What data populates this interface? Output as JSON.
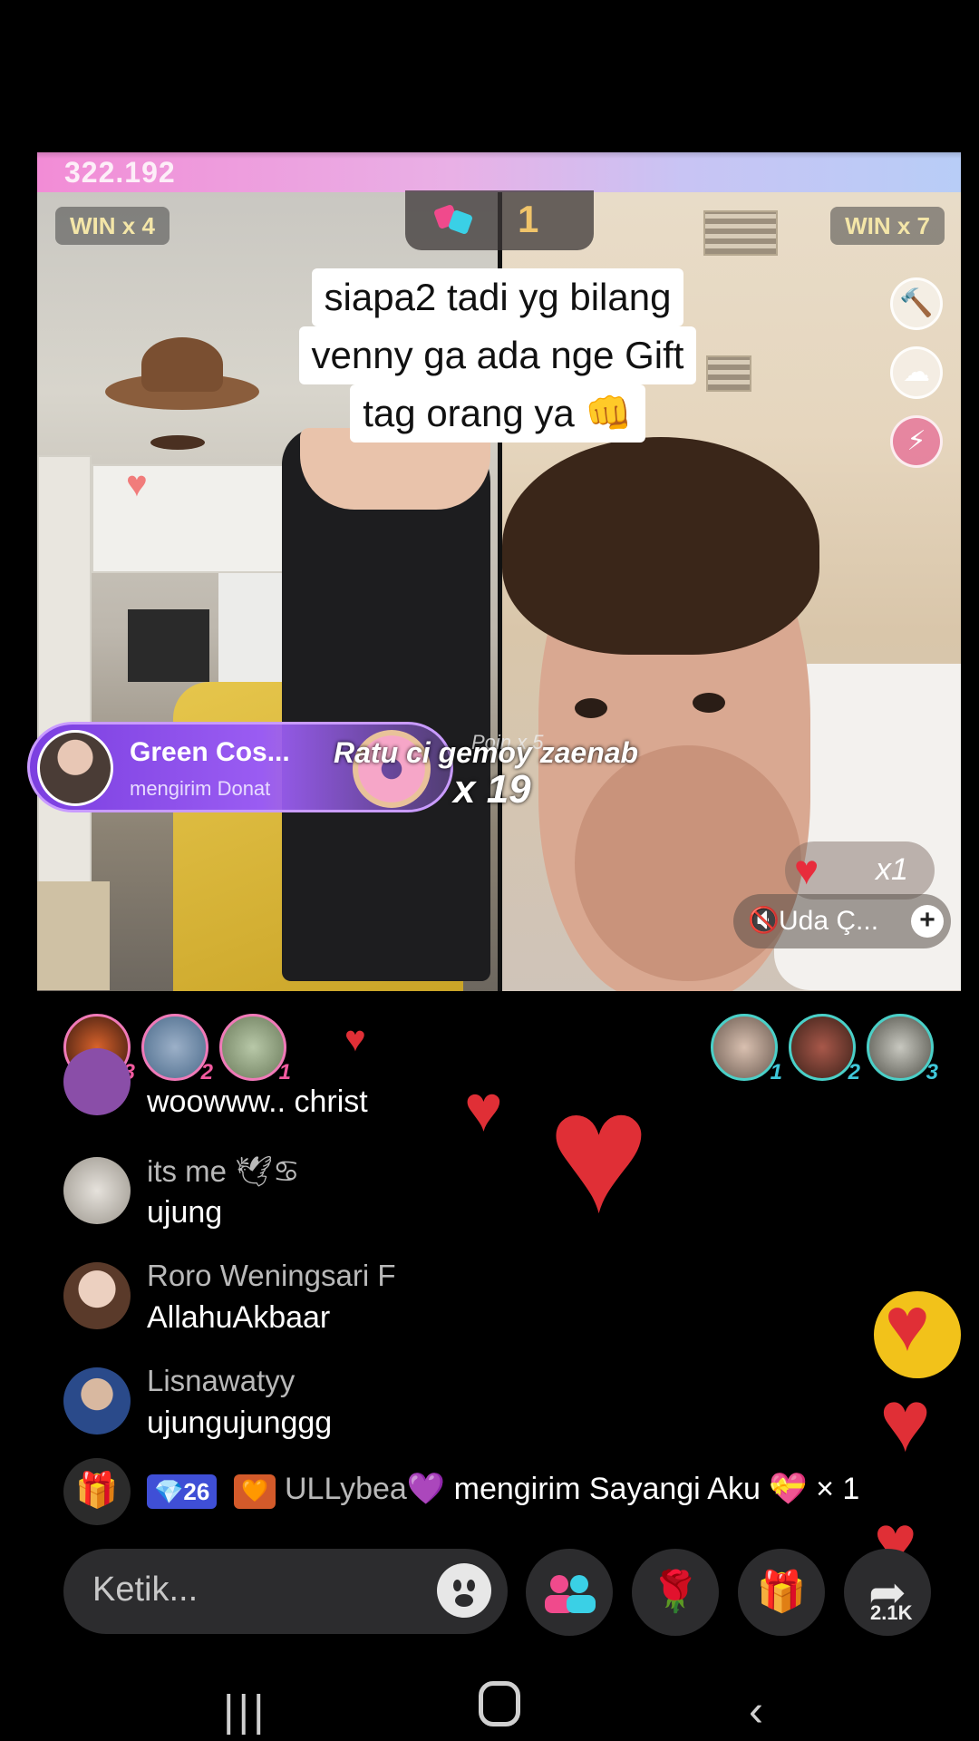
{
  "battle": {
    "score": "322.192",
    "win_left": "WIN x 4",
    "win_right": "WIN x 7",
    "round": "1",
    "caption_lines": [
      "siapa2 tadi yg bilang",
      "venny ga ada nge Gift",
      "tag orang ya 👊"
    ]
  },
  "gift_toast": {
    "sender": "Green Cos...",
    "action": "mengirim Donat",
    "overlay_name": "Ratu ci gemoy zaenab",
    "overlay_count": "x 19",
    "poin": "Poin x 5"
  },
  "heart_counter": {
    "count": "x1"
  },
  "opponent": {
    "name": "Uda Ç..."
  },
  "supporters_left": [
    {
      "rank": "3"
    },
    {
      "rank": "2"
    },
    {
      "rank": "1"
    }
  ],
  "supporters_right": [
    {
      "rank": "1"
    },
    {
      "rank": "2"
    },
    {
      "rank": "3"
    }
  ],
  "chat": [
    {
      "user": "",
      "message": "woowww.. christ"
    },
    {
      "user": "its me 🕊♋",
      "message": "ujung"
    },
    {
      "user": "Roro Weningsari F",
      "message": "AllahuAkbaar"
    },
    {
      "user": "Lisnawatyy",
      "message": "ujungujunggg"
    }
  ],
  "gift_line": {
    "badge_level": "💎26",
    "user": "ULLybea💜",
    "text": " mengirim Sayangi Aku 💝 × 1"
  },
  "input": {
    "placeholder": "Ketik..."
  },
  "share": {
    "count": "2.1K"
  },
  "icons": {
    "gift": "gift-icon",
    "emoji": "smile-icon",
    "guests": "guests-icon",
    "rose": "rose-icon",
    "present": "present-icon",
    "share": "share-icon"
  },
  "colors": {
    "accent_pink": "#f07ab8",
    "accent_teal": "#4ad0c8",
    "toast_purple": "#8b4ee8",
    "heart_red": "#e02f36"
  }
}
